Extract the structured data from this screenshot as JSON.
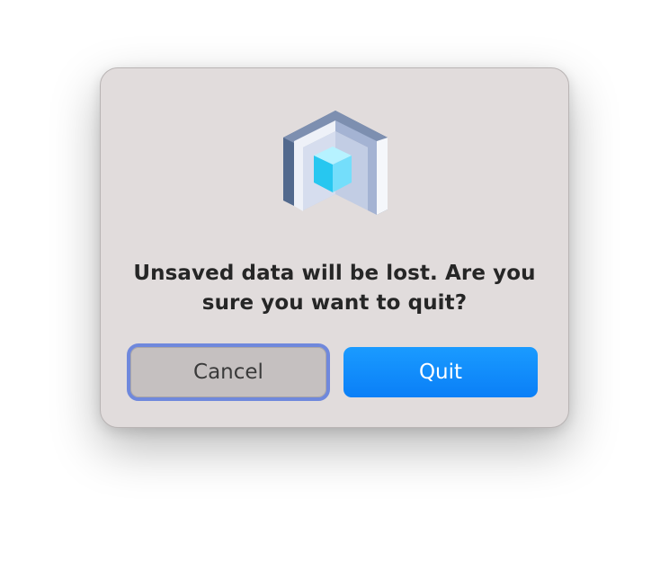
{
  "dialog": {
    "icon": "app-cube-icon",
    "message": "Unsaved data will be lost. Are you sure you want to quit?",
    "buttons": {
      "cancel_label": "Cancel",
      "quit_label": "Quit"
    }
  },
  "colors": {
    "dialog_background": "#e1dcdc",
    "primary_button": "#0a84ff",
    "focus_ring": "#6f88dc",
    "secondary_button": "#c5c0c0"
  }
}
